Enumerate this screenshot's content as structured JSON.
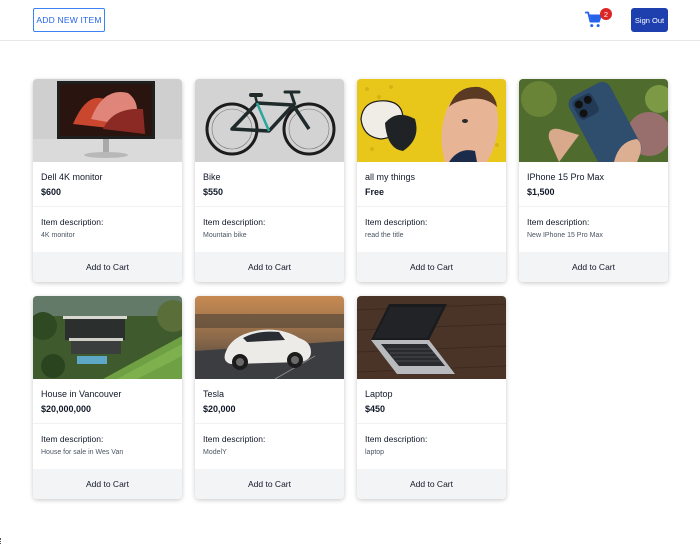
{
  "header": {
    "add_item_label": "ADD NEW ITEM",
    "cart_icon": "shopping-cart-icon",
    "cart_count": "2",
    "sign_out_label": "Sign Out"
  },
  "colors": {
    "accent": "#2563eb",
    "sign_out_bg": "#1e40af",
    "badge": "#dc2626",
    "cart_button_bg": "#f3f4f6"
  },
  "products": [
    {
      "title": "Dell 4K monitor",
      "price": "$600",
      "desc_label": "Item description:",
      "description": "4K monitor",
      "button": "Add to Cart"
    },
    {
      "title": "Bike",
      "price": "$550",
      "desc_label": "Item description:",
      "description": "Mountain bike",
      "button": "Add to Cart"
    },
    {
      "title": "all my things",
      "price": "Free",
      "desc_label": "Item description:",
      "description": "read the title",
      "button": "Add to Cart"
    },
    {
      "title": "IPhone 15 Pro Max",
      "price": "$1,500",
      "desc_label": "Item description:",
      "description": "New IPhone 15 Pro Max",
      "button": "Add to Cart"
    },
    {
      "title": "House in Vancouver",
      "price": "$20,000,000",
      "desc_label": "Item description:",
      "description": "House for sale in Wes Van",
      "button": "Add to Cart"
    },
    {
      "title": "Tesla",
      "price": "$20,000",
      "desc_label": "Item description:",
      "description": "ModelY",
      "button": "Add to Cart"
    },
    {
      "title": "Laptop",
      "price": "$450",
      "desc_label": "Item description:",
      "description": "laptop",
      "button": "Add to Cart"
    }
  ]
}
